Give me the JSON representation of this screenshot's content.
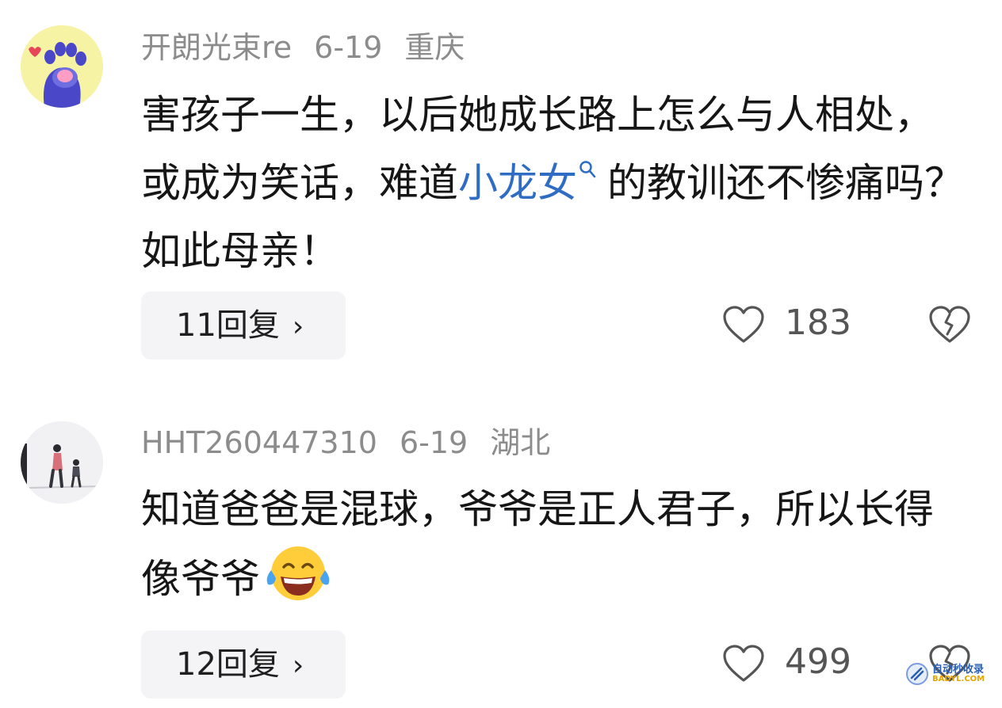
{
  "comments": [
    {
      "username": "开朗光束re",
      "date": "6-19",
      "location": "重庆",
      "text_before": "害孩子一生，以后她成长路上怎么与人相处，或成为笑话，难道",
      "keyword": "小龙女",
      "text_after": "的教训还不惨痛吗？如此母亲！",
      "reply_label": "11回复",
      "reply_chevron": "›",
      "likes": "183",
      "icons": {
        "avatar": "paw-avatar",
        "like": "heart-outline-icon",
        "dislike": "broken-heart-icon",
        "keyword": "search-icon"
      }
    },
    {
      "username": "HHT260447310",
      "date": "6-19",
      "location": "湖北",
      "text": "知道爸爸是混球，爷爷是正人君子，所以长得像爷爷",
      "emoji": "laughing-tears-emoji",
      "reply_label": "12回复",
      "reply_chevron": "›",
      "likes": "499",
      "icons": {
        "avatar": "photo-avatar",
        "like": "heart-outline-icon",
        "dislike": "broken-heart-icon"
      }
    }
  ],
  "watermark": {
    "line1": "自动秒收录",
    "line2": "BADYL.COM"
  },
  "colors": {
    "keyword": "#2f6dc4",
    "meta": "#8c8c8c",
    "pill": "#f4f4f6"
  }
}
